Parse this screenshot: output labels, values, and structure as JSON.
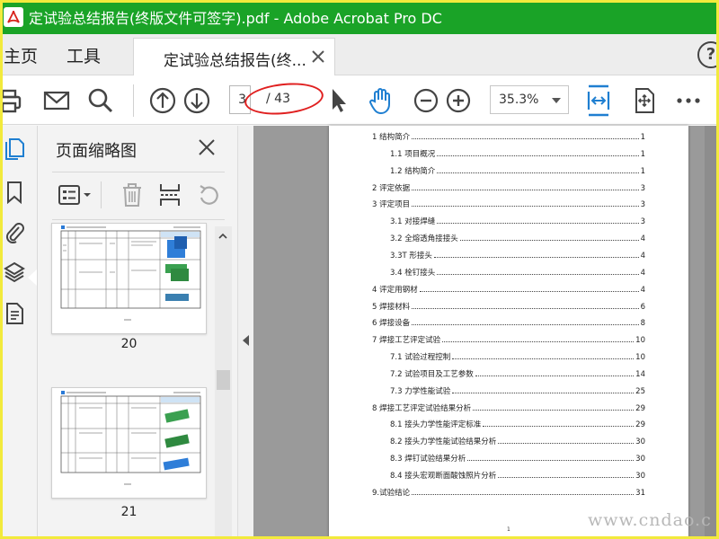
{
  "window": {
    "title": "定试验总结报告(终版文件可签字).pdf - Adobe Acrobat Pro DC",
    "title_bar_color": "#1aa327"
  },
  "nav": {
    "home": "主页",
    "tools": "工具",
    "doc_tab": "定试验总结报告(终...",
    "help": "?"
  },
  "toolbar": {
    "current_page": "3",
    "total_pages": "/ 43",
    "zoom": "35.3%",
    "icons": [
      "print-icon",
      "email-icon",
      "search-icon",
      "page-up-icon",
      "page-down-icon",
      "select-cursor-icon",
      "hand-tool-icon",
      "zoom-out-icon",
      "zoom-in-icon",
      "fit-width-icon",
      "scroll-mode-icon",
      "more-icon"
    ],
    "highlight_color": "#e02020"
  },
  "sidebar": {
    "icons": [
      "page-thumbnails-icon",
      "bookmarks-icon",
      "attachments-icon",
      "layers-icon",
      "page-content-icon"
    ]
  },
  "thumbnails_panel": {
    "title": "页面缩略图",
    "pages": [
      {
        "number": "20"
      },
      {
        "number": "21"
      }
    ]
  },
  "document": {
    "toc": [
      {
        "text": "1 结构简介",
        "page": "1",
        "level": 1
      },
      {
        "text": "1.1 项目概况",
        "page": "1",
        "level": 2
      },
      {
        "text": "1.2 结构简介",
        "page": "1",
        "level": 2
      },
      {
        "text": "2 评定依据",
        "page": "3",
        "level": 1
      },
      {
        "text": "3 评定项目",
        "page": "3",
        "level": 1
      },
      {
        "text": "3.1 对接焊缝",
        "page": "3",
        "level": 2
      },
      {
        "text": "3.2 全熔透角接接头",
        "page": "4",
        "level": 2
      },
      {
        "text": "3.3T 形接头",
        "page": "4",
        "level": 2
      },
      {
        "text": "3.4 栓钉接头",
        "page": "4",
        "level": 2
      },
      {
        "text": "4 评定用钢材",
        "page": "4",
        "level": 1
      },
      {
        "text": "5 焊接材料",
        "page": "6",
        "level": 1
      },
      {
        "text": "6 焊接设备",
        "page": "8",
        "level": 1
      },
      {
        "text": "7 焊接工艺评定试验",
        "page": "10",
        "level": 1
      },
      {
        "text": "7.1 试验过程控制",
        "page": "10",
        "level": 2
      },
      {
        "text": "7.2 试验项目及工艺参数",
        "page": "14",
        "level": 2
      },
      {
        "text": "7.3 力学性能试验",
        "page": "25",
        "level": 2
      },
      {
        "text": "8 焊接工艺评定试验结果分析",
        "page": "29",
        "level": 1
      },
      {
        "text": "8.1 接头力学性能评定标准",
        "page": "29",
        "level": 2
      },
      {
        "text": "8.2 接头力学性能试验结果分析",
        "page": "30",
        "level": 2
      },
      {
        "text": "8.3 焊钉试验结果分析",
        "page": "30",
        "level": 2
      },
      {
        "text": "8.4 接头宏观断面酸蚀照片分析",
        "page": "30",
        "level": 2
      },
      {
        "text": "9.试验结论",
        "page": "31",
        "level": 1
      }
    ],
    "page_footer": "1"
  },
  "watermark": "www.cndao.c"
}
